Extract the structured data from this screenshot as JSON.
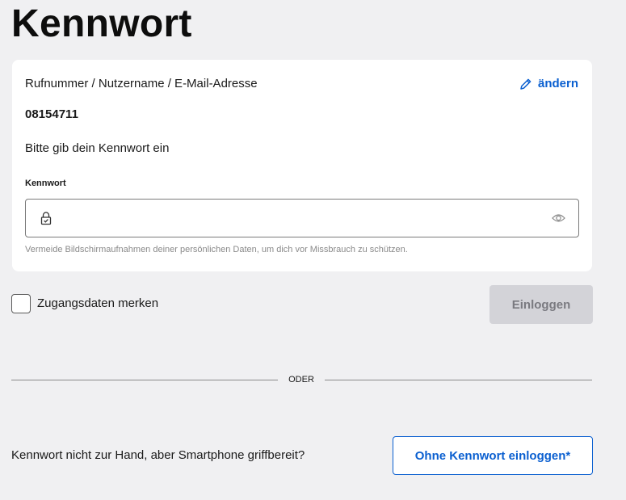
{
  "page": {
    "title": "Kennwort"
  },
  "card": {
    "user_label": "Rufnummer / Nutzername / E-Mail-Adresse",
    "change_label": "ändern",
    "change_icon": "pencil-icon",
    "user_value": "08154711",
    "prompt": "Bitte gib dein Kennwort ein",
    "password_field": {
      "label": "Kennwort",
      "value": "",
      "placeholder": "",
      "lock_icon": "lock-icon",
      "toggle_icon": "eye-icon"
    },
    "hint": "Vermeide Bildschirmaufnahmen deiner persönlichen Daten, um dich vor Missbrauch zu schützen."
  },
  "remember": {
    "label": "Zugangsdaten merken",
    "checked": false
  },
  "login_button": {
    "label": "Einloggen",
    "disabled": true
  },
  "divider": {
    "text": "ODER"
  },
  "alternative": {
    "question": "Kennwort nicht zur Hand, aber Smartphone griffbereit?",
    "button_label": "Ohne Kennwort einloggen*"
  },
  "colors": {
    "background": "#f0f0f2",
    "card": "#ffffff",
    "link": "#0a5fd0",
    "disabled_button": "#d3d3d8",
    "disabled_text": "#7a7a80"
  }
}
